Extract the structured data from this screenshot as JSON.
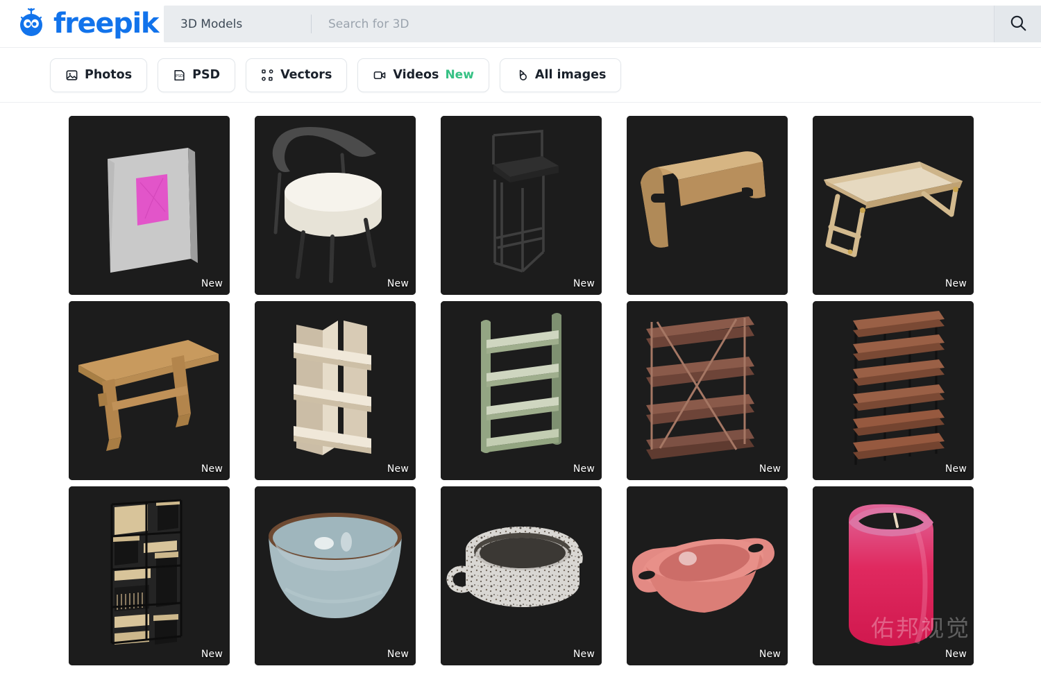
{
  "header": {
    "brand": "freepik",
    "logo_icon": "freepik-robot-logo",
    "search": {
      "category": "3D Models",
      "placeholder": "Search for 3D",
      "value": "",
      "button_icon": "search-icon"
    }
  },
  "filters": [
    {
      "label": "Photos",
      "icon": "photo-icon",
      "badge": ""
    },
    {
      "label": "PSD",
      "icon": "psd-file-icon",
      "badge": ""
    },
    {
      "label": "Vectors",
      "icon": "vector-nodes-icon",
      "badge": ""
    },
    {
      "label": "Videos",
      "icon": "video-camera-icon",
      "badge": "New"
    },
    {
      "label": "All images",
      "icon": "all-images-icon",
      "badge": ""
    }
  ],
  "colors": {
    "brand_blue": "#1273eb",
    "badge_green": "#35c184",
    "card_bg": "#1c1c1c",
    "page_bg": "#ffffff",
    "search_bg": "#e9ecef"
  },
  "watermark": "佑邦视觉",
  "grid": {
    "badge_new": "New",
    "items": [
      {
        "name": "canvas-frame-art",
        "badge": "New"
      },
      {
        "name": "round-armchair",
        "badge": "New"
      },
      {
        "name": "black-bar-stool",
        "badge": "New"
      },
      {
        "name": "wooden-lap-desk",
        "badge": ""
      },
      {
        "name": "folding-bed-tray-table",
        "badge": "New"
      },
      {
        "name": "wooden-bench-table",
        "badge": "New"
      },
      {
        "name": "cream-wooden-shelf",
        "badge": "New"
      },
      {
        "name": "green-shoe-rack",
        "badge": "New"
      },
      {
        "name": "walnut-x-bookshelf",
        "badge": "New"
      },
      {
        "name": "tall-metal-wood-rack",
        "badge": "New"
      },
      {
        "name": "modular-cube-bookcase",
        "badge": "New"
      },
      {
        "name": "blue-ceramic-bowl",
        "badge": "New"
      },
      {
        "name": "terrazzo-handled-bowl",
        "badge": "New"
      },
      {
        "name": "pink-handled-dish",
        "badge": "New"
      },
      {
        "name": "pink-pillar-candle",
        "badge": "New"
      }
    ]
  }
}
